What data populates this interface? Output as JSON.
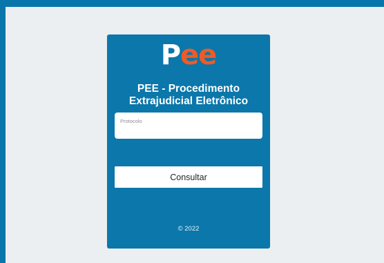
{
  "logo": {
    "part1": "P",
    "part2": "ee",
    "colors": {
      "p": "#ffffff",
      "ee": "#f15a24"
    }
  },
  "title": {
    "line1": "PEE - Procedimento",
    "line2": "Extrajudicial Eletrônico"
  },
  "form": {
    "protocol_label": "Protocolo",
    "protocol_value": "",
    "submit_label": "Consultar"
  },
  "footer": {
    "copyright": "© 2022"
  },
  "colors": {
    "frame": "#0876ab",
    "background": "#eceff1",
    "card": "#0b77aa"
  }
}
